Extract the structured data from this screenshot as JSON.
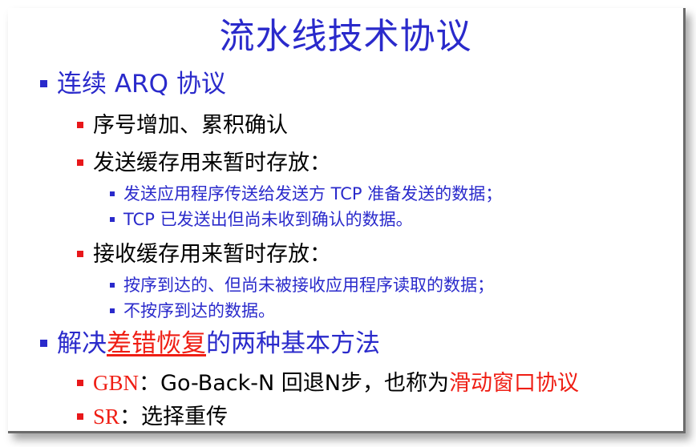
{
  "slide": {
    "title": "流水线技术协议",
    "items": [
      {
        "text": "连续 ARQ 协议"
      },
      {
        "text": "序号增加、累积确认"
      },
      {
        "text": "发送缓存用来暂时存放："
      },
      {
        "text": "发送应用程序传送给发送方 TCP 准备发送的数据；"
      },
      {
        "text": "TCP 已发送出但尚未收到确认的数据。"
      },
      {
        "text": "接收缓存用来暂时存放："
      },
      {
        "text": "按序到达的、但尚未被接收应用程序读取的数据；"
      },
      {
        "text": "不按序到达的数据。"
      },
      {
        "text_part1": "解决",
        "text_highlight": "差错恢复",
        "text_part2": "的两种基本方法"
      },
      {
        "label": "GBN",
        "text_part1": "：Go-Back-N 回退N步，也称为",
        "text_highlight": "滑动窗口协议"
      },
      {
        "label": "SR",
        "text_part1": "：选择重传"
      }
    ]
  },
  "colors": {
    "accent_blue": "#2a2acb",
    "accent_red": "#ef1e14",
    "bullet_red": "#e8171a",
    "text": "#000000"
  }
}
